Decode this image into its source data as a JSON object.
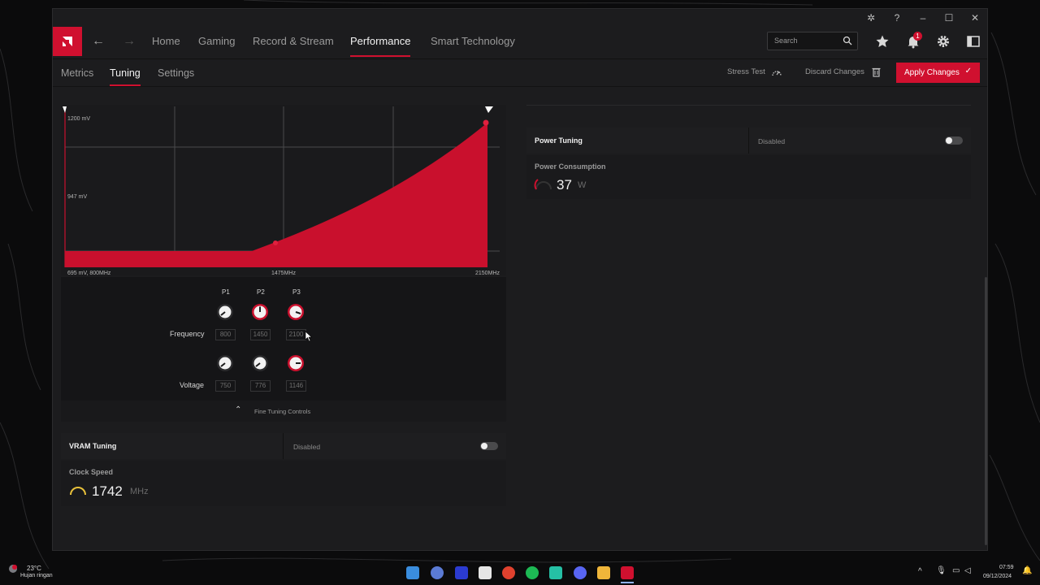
{
  "window": {
    "titlebar_icons": [
      "bug-icon",
      "help-icon",
      "minimize-icon",
      "maximize-icon",
      "close-icon"
    ]
  },
  "nav": {
    "items": [
      "Home",
      "Gaming",
      "Record & Stream",
      "Performance",
      "Smart Technology"
    ],
    "active": "Performance",
    "search_placeholder": "Search",
    "notification_count": "1"
  },
  "subnav": {
    "items": [
      "Metrics",
      "Tuning",
      "Settings"
    ],
    "active": "Tuning",
    "stress_test": "Stress Test",
    "discard": "Discard Changes",
    "apply": "Apply Changes"
  },
  "curve": {
    "ticks": {
      "y_top": "1200 mV",
      "y_mid": "947 mV",
      "x_left": "695 mV, 800MHz",
      "x_mid": "1475MHz",
      "x_right": "2150MHz"
    },
    "color": "#d0102f"
  },
  "controls": {
    "columns": [
      "P1",
      "P2",
      "P3"
    ],
    "frequency_label": "Frequency",
    "voltage_label": "Voltage",
    "frequency_values": [
      "800",
      "1450",
      "2100"
    ],
    "voltage_values": [
      "750",
      "776",
      "1146"
    ],
    "fine_tuning": "Fine Tuning Controls"
  },
  "vram": {
    "title": "VRAM Tuning",
    "status": "Disabled",
    "metric_label": "Clock Speed",
    "value": "1742",
    "unit": "MHz",
    "gauge_color": "#e8c13a"
  },
  "power": {
    "title": "Power Tuning",
    "status": "Disabled",
    "metric_label": "Power Consumption",
    "value": "37",
    "unit": "W",
    "gauge_color": "#d0102f"
  },
  "taskbar": {
    "weather_temp": "23°C",
    "weather_desc": "Hujan ringan",
    "time": "07:59",
    "date": "09/12/2024",
    "apps": [
      "windows-start-icon",
      "copilot-icon",
      "notes-icon",
      "notion-icon",
      "chrome-icon",
      "spotify-icon",
      "whatsapp-icon",
      "discord-icon",
      "explorer-icon",
      "amd-icon"
    ]
  }
}
